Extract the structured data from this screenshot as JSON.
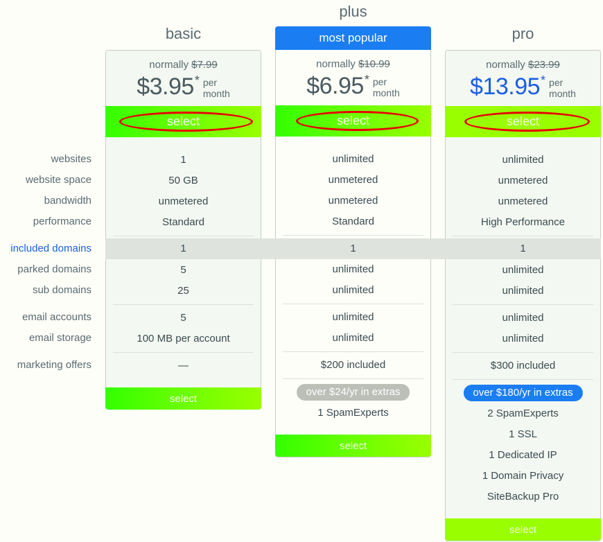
{
  "feature_labels": [
    "websites",
    "website space",
    "bandwidth",
    "performance",
    "included domains",
    "parked domains",
    "sub domains",
    "email accounts",
    "email storage",
    "marketing offers"
  ],
  "highlighted_feature": "included domains",
  "colors": {
    "accent_blue": "#1a7ef2",
    "select_green_start": "#33ff00",
    "select_green_end": "#99ff00",
    "annotation_red": "#e80000",
    "highlight_band": "#dfe3dd"
  },
  "plans": [
    {
      "name": "basic",
      "normally_label": "normally",
      "old_price": "$7.99",
      "price": "$3.95",
      "asterisk": "*",
      "per": "per",
      "period": "month",
      "select_label": "select",
      "features": {
        "websites": "1",
        "website_space": "50 GB",
        "bandwidth": "unmetered",
        "performance": "Standard",
        "included_domains": "1",
        "parked_domains": "5",
        "sub_domains": "25",
        "email_accounts": "5",
        "email_storage": "100 MB per account",
        "marketing_offers": "—"
      }
    },
    {
      "name": "plus",
      "badge": "most popular",
      "normally_label": "normally",
      "old_price": "$10.99",
      "price": "$6.95",
      "asterisk": "*",
      "per": "per",
      "period": "month",
      "select_label": "select",
      "features": {
        "websites": "unlimited",
        "website_space": "unmetered",
        "bandwidth": "unmetered",
        "performance": "Standard",
        "included_domains": "1",
        "parked_domains": "unlimited",
        "sub_domains": "unlimited",
        "email_accounts": "unlimited",
        "email_storage": "unlimited",
        "marketing_offers": "$200 included"
      },
      "extras_badge": "over $24/yr in extras",
      "extras": [
        "1 SpamExperts"
      ]
    },
    {
      "name": "pro",
      "normally_label": "normally",
      "old_price": "$23.99",
      "price": "$13.95",
      "asterisk": "*",
      "per": "per",
      "period": "month",
      "select_label": "select",
      "features": {
        "websites": "unlimited",
        "website_space": "unmetered",
        "bandwidth": "unmetered",
        "performance": "High Performance",
        "included_domains": "1",
        "parked_domains": "unlimited",
        "sub_domains": "unlimited",
        "email_accounts": "unlimited",
        "email_storage": "unlimited",
        "marketing_offers": "$300 included"
      },
      "extras_badge": "over $180/yr in extras",
      "extras": [
        "2 SpamExperts",
        "1 SSL",
        "1 Dedicated IP",
        "1 Domain Privacy",
        "SiteBackup Pro"
      ]
    }
  ]
}
